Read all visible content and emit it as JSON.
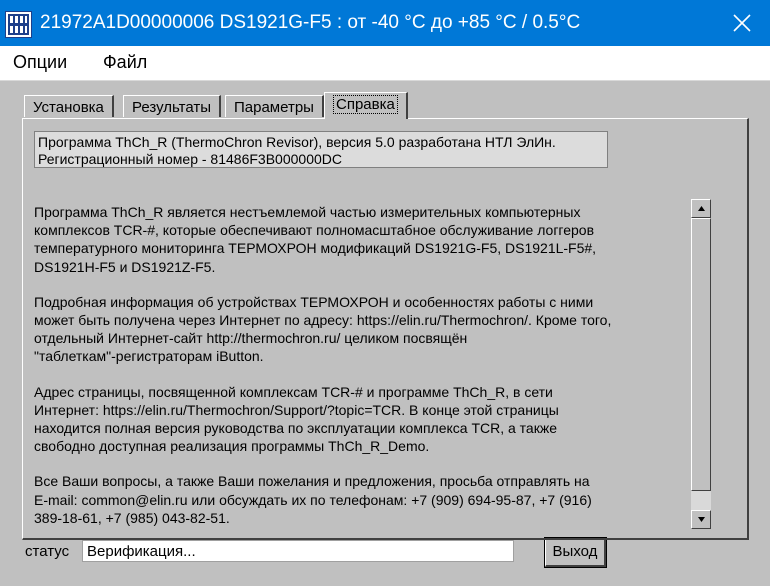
{
  "window": {
    "title": "21972A1D00000006      DS1921G-F5 : от -40 °C до +85 °C / 0.5°C",
    "icon": "thermochron-app-icon",
    "close_icon": "close-icon"
  },
  "menu": {
    "items": [
      {
        "label": "Опции"
      },
      {
        "label": "Файл"
      }
    ]
  },
  "tabs": [
    {
      "label": "Установка",
      "active": false
    },
    {
      "label": "Результаты",
      "active": false
    },
    {
      "label": "Параметры",
      "active": false
    },
    {
      "label": "Справка",
      "active": true
    }
  ],
  "info": {
    "line1": "Программа ThCh_R (ThermoChron Revisor), версия 5.0 разработана НТЛ ЭлИн.",
    "line2": "Регистрационный номер - 81486F3B000000DC"
  },
  "help": {
    "paragraphs": [
      "Программа ThCh_R является нестъемлемой частью измерительных компьютерных\nкомплексов TCR-#, которые обеспечивают полномасштабное обслуживание логгеров\nтемпературного мониторинга ТЕРМОХРОН модификаций DS1921G-F5, DS1921L-F5#,\nDS1921H-F5 и DS1921Z-F5.",
      "Подробная информация об устройствах ТЕРМОХРОН и особенностях работы с ними\nможет быть получена через Интернет по адресу: https://elin.ru/Thermochron/. Кроме того,\nотдельный Интернет-сайт http://thermochron.ru/ целиком посвящён\n\"таблеткам\"-регистраторам iButton.",
      "Адрес страницы, посвященной комплексам TCR-# и программе ThCh_R, в сети\nИнтернет: https://elin.ru/Thermochron/Support/?topic=TCR. В конце этой страницы\nнаходится полная версия руководства по эксплуатации комплекса TCR, а также\nсвободно доступная реализация программы ThCh_R_Demo.",
      "Все Ваши вопросы, а также Ваши пожелания и предложения, просьба отправлять на\nE-mail: common@elin.ru или обсуждать их по телефонам: +7 (909) 694-95-87, +7 (916)\n389-18-61, +7 (985) 043-82-51."
    ]
  },
  "status": {
    "label": "статус",
    "value": "Верификация..."
  },
  "buttons": {
    "exit": "Выход"
  },
  "colors": {
    "titlebar": "#0078d7",
    "window_bg": "#c0c0c0"
  }
}
